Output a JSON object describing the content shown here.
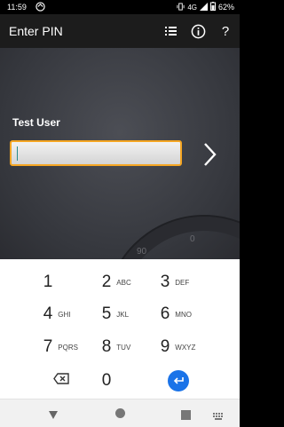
{
  "status": {
    "time": "11:59",
    "network": "4G",
    "battery": "62%"
  },
  "appbar": {
    "title": "Enter PIN"
  },
  "login": {
    "user_name": "Test User",
    "pin_value": ""
  },
  "dial": {
    "ticks": [
      "90",
      "0"
    ]
  },
  "keypad": {
    "keys": [
      {
        "num": "1",
        "letters": ""
      },
      {
        "num": "2",
        "letters": "ABC"
      },
      {
        "num": "3",
        "letters": "DEF"
      },
      {
        "num": "4",
        "letters": "GHI"
      },
      {
        "num": "5",
        "letters": "JKL"
      },
      {
        "num": "6",
        "letters": "MNO"
      },
      {
        "num": "7",
        "letters": "PQRS"
      },
      {
        "num": "8",
        "letters": "TUV"
      },
      {
        "num": "9",
        "letters": "WXYZ"
      },
      {
        "num": "0",
        "letters": ""
      }
    ]
  },
  "colors": {
    "accent": "#f5a623",
    "enter_key": "#1a73e8"
  }
}
